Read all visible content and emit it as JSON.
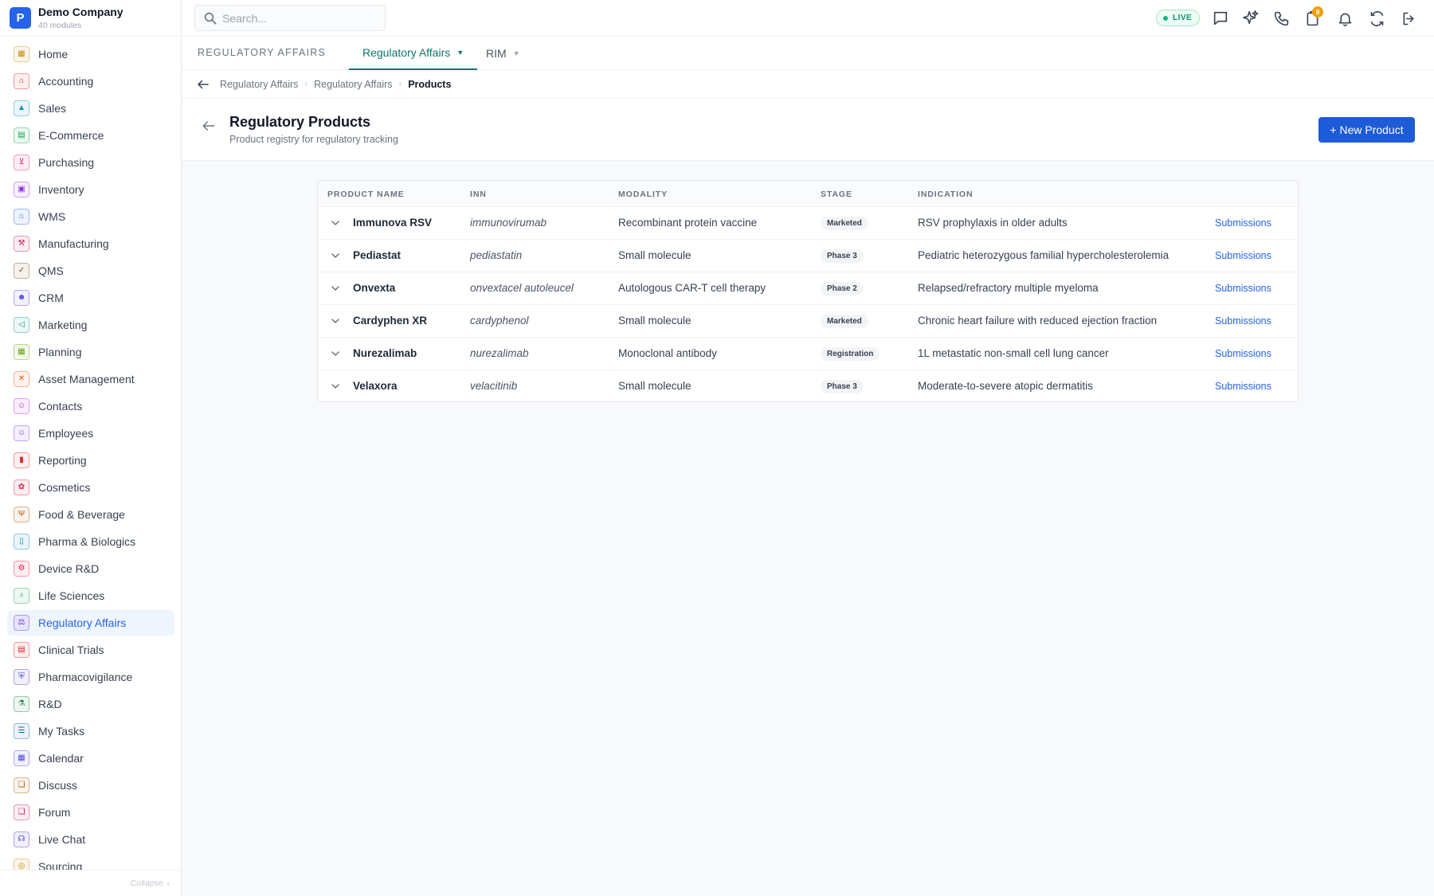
{
  "company": {
    "initial": "P",
    "name": "Demo Company",
    "modules": "40 modules"
  },
  "search": {
    "placeholder": "Search..."
  },
  "topbar": {
    "live": "LIVE",
    "notifications_count": "9"
  },
  "nav": {
    "items": [
      {
        "label": "Home",
        "icon": "home-grid-icon",
        "color": "#ca8a04",
        "glyph": "▦"
      },
      {
        "label": "Accounting",
        "icon": "bank-icon",
        "color": "#dc2626",
        "glyph": "⌂"
      },
      {
        "label": "Sales",
        "icon": "sales-icon",
        "color": "#0891b2",
        "glyph": "▲"
      },
      {
        "label": "E-Commerce",
        "icon": "store-icon",
        "color": "#16a34a",
        "glyph": "▤"
      },
      {
        "label": "Purchasing",
        "icon": "cart-icon",
        "color": "#db2777",
        "glyph": "⊻"
      },
      {
        "label": "Inventory",
        "icon": "box-icon",
        "color": "#9333ea",
        "glyph": "▣"
      },
      {
        "label": "WMS",
        "icon": "warehouse-icon",
        "color": "#2563eb",
        "glyph": "⌂"
      },
      {
        "label": "Manufacturing",
        "icon": "factory-icon",
        "color": "#be185d",
        "glyph": "⚒"
      },
      {
        "label": "QMS",
        "icon": "quality-icon",
        "color": "#854d0e",
        "glyph": "✓"
      },
      {
        "label": "CRM",
        "icon": "people-icon",
        "color": "#4f46e5",
        "glyph": "☻"
      },
      {
        "label": "Marketing",
        "icon": "megaphone-icon",
        "color": "#0d9488",
        "glyph": "◁"
      },
      {
        "label": "Planning",
        "icon": "planning-icon",
        "color": "#65a30d",
        "glyph": "▦"
      },
      {
        "label": "Asset Management",
        "icon": "tools-icon",
        "color": "#ea580c",
        "glyph": "✕"
      },
      {
        "label": "Contacts",
        "icon": "contact-icon",
        "color": "#c026d3",
        "glyph": "☺"
      },
      {
        "label": "Employees",
        "icon": "employee-icon",
        "color": "#7c3aed",
        "glyph": "☺"
      },
      {
        "label": "Reporting",
        "icon": "bar-chart-icon",
        "color": "#dc2626",
        "glyph": "▮"
      },
      {
        "label": "Cosmetics",
        "icon": "cosmetics-icon",
        "color": "#e11d48",
        "glyph": "✿"
      },
      {
        "label": "Food & Beverage",
        "icon": "utensils-icon",
        "color": "#b45309",
        "glyph": "Ψ"
      },
      {
        "label": "Pharma & Biologics",
        "icon": "pill-bottle-icon",
        "color": "#0284c7",
        "glyph": "▯"
      },
      {
        "label": "Device R&D",
        "icon": "device-icon",
        "color": "#e11d48",
        "glyph": "⚙"
      },
      {
        "label": "Life Sciences",
        "icon": "microscope-icon",
        "color": "#16a34a",
        "glyph": "♁"
      },
      {
        "label": "Regulatory Affairs",
        "icon": "gavel-icon",
        "color": "#6d28d9",
        "glyph": "⚖"
      },
      {
        "label": "Clinical Trials",
        "icon": "clipboard-icon",
        "color": "#dc2626",
        "glyph": "▤"
      },
      {
        "label": "Pharmacovigilance",
        "icon": "shield-icon",
        "color": "#4338ca",
        "glyph": "⛨"
      },
      {
        "label": "R&D",
        "icon": "flask-icon",
        "color": "#15803d",
        "glyph": "⚗"
      },
      {
        "label": "My Tasks",
        "icon": "checklist-icon",
        "color": "#0369a1",
        "glyph": "☰"
      },
      {
        "label": "Calendar",
        "icon": "calendar-icon",
        "color": "#4f46e5",
        "glyph": "▦"
      },
      {
        "label": "Discuss",
        "icon": "chat-bubbles-icon",
        "color": "#a16207",
        "glyph": "❏"
      },
      {
        "label": "Forum",
        "icon": "forum-icon",
        "color": "#be185d",
        "glyph": "❏"
      },
      {
        "label": "Live Chat",
        "icon": "headset-icon",
        "color": "#4338ca",
        "glyph": "☊"
      },
      {
        "label": "Sourcing",
        "icon": "sourcing-icon",
        "color": "#ca8a04",
        "glyph": "◎"
      }
    ],
    "collapse": "Collapse"
  },
  "module_tabs": {
    "module": "REGULATORY AFFAIRS",
    "tabs": [
      {
        "label": "Regulatory Affairs"
      },
      {
        "label": "RIM"
      }
    ]
  },
  "breadcrumb": [
    "Regulatory Affairs",
    "Regulatory Affairs",
    "Products"
  ],
  "page": {
    "title": "Regulatory Products",
    "subtitle": "Product registry for regulatory tracking",
    "new_button": "+ New Product"
  },
  "table": {
    "columns": [
      "PRODUCT NAME",
      "INN",
      "MODALITY",
      "STAGE",
      "INDICATION"
    ],
    "rows": [
      {
        "name": "Immunova RSV",
        "inn": "immunovirumab",
        "modality": "Recombinant protein vaccine",
        "stage": "Marketed",
        "indication": "RSV prophylaxis in older adults",
        "action": "Submissions"
      },
      {
        "name": "Pediastat",
        "inn": "pediastatin",
        "modality": "Small molecule",
        "stage": "Phase 3",
        "indication": "Pediatric heterozygous familial hypercholesterolemia",
        "action": "Submissions"
      },
      {
        "name": "Onvexta",
        "inn": "onvextacel autoleucel",
        "modality": "Autologous CAR-T cell therapy",
        "stage": "Phase 2",
        "indication": "Relapsed/refractory multiple myeloma",
        "action": "Submissions"
      },
      {
        "name": "Cardyphen XR",
        "inn": "cardyphenol",
        "modality": "Small molecule",
        "stage": "Marketed",
        "indication": "Chronic heart failure with reduced ejection fraction",
        "action": "Submissions"
      },
      {
        "name": "Nurezalimab",
        "inn": "nurezalimab",
        "modality": "Monoclonal antibody",
        "stage": "Registration",
        "indication": "1L metastatic non-small cell lung cancer",
        "action": "Submissions"
      },
      {
        "name": "Velaxora",
        "inn": "velacitinib",
        "modality": "Small molecule",
        "stage": "Phase 3",
        "indication": "Moderate-to-severe atopic dermatitis",
        "action": "Submissions"
      }
    ]
  },
  "colors": {
    "primary": "#1d5bd8",
    "accent_teal": "#0f766e",
    "live_green": "#10b981",
    "badge_orange": "#f59e0b"
  }
}
